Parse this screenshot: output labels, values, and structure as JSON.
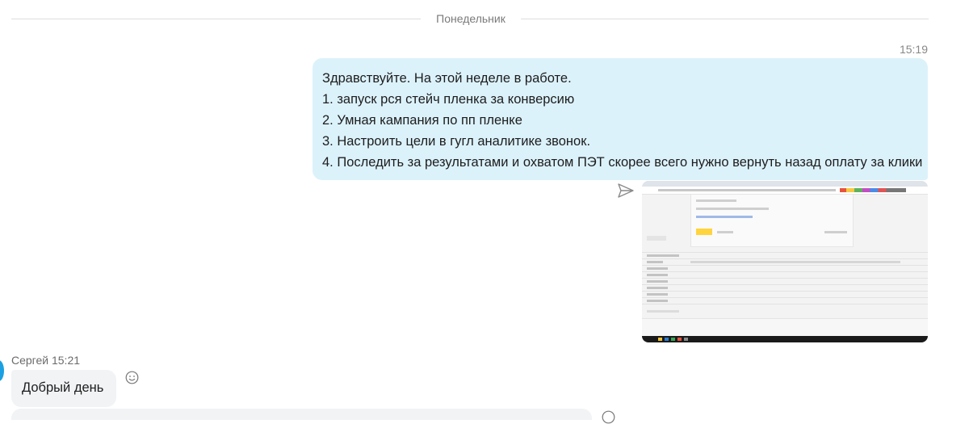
{
  "day_separator": "Понедельник",
  "outgoing": {
    "time": "15:19",
    "lines": [
      "Здравствуйте. На этой неделе в работе.",
      "1. запуск  рся стейч пленка за конверсию",
      "2. Умная кампания по пп пленке",
      "3. Настроить цели в гугл аналитике звонок.",
      "4. Последить за результатами и охватом ПЭТ скорее всего нужно вернуть назад оплату за клики"
    ],
    "status_icon": "sent-icon",
    "attachment": "screenshot-image"
  },
  "incoming": {
    "sender": "Сергей",
    "time": "15:21",
    "text": "Добрый день",
    "reaction_icon": "smile-icon"
  },
  "colors": {
    "outgoing_bubble": "#dcf2fb",
    "incoming_bubble": "#f1f3f5",
    "avatar": "#1ba1e2"
  }
}
